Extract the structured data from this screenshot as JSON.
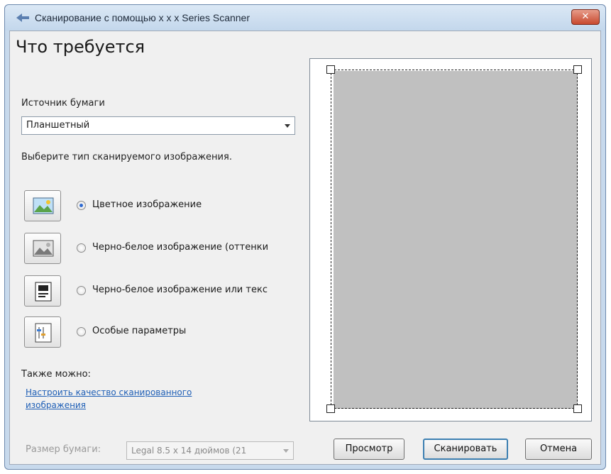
{
  "window": {
    "title": "Сканирование с помощью  x x x  Series Scanner",
    "close_label": "✕"
  },
  "left": {
    "heading": "Что требуется",
    "source_label": "Источник бумаги",
    "source_value": "Планшетный",
    "type_prompt": "Выберите тип сканируемого изображения.",
    "types": [
      {
        "label": "Цветное изображение",
        "selected": true,
        "icon": "color-image-icon"
      },
      {
        "label": "Черно-белое изображение (оттенки",
        "selected": false,
        "icon": "grayscale-image-icon"
      },
      {
        "label": "Черно-белое изображение или текс",
        "selected": false,
        "icon": "bw-text-icon"
      },
      {
        "label": "Особые параметры",
        "selected": false,
        "icon": "custom-settings-icon"
      }
    ],
    "also_label": "Также можно:",
    "link_line1": "Настроить качество сканированного",
    "link_line2": "изображения",
    "page_size_label": "Размер бумаги:",
    "page_size_value": "Legal 8.5 x 14 дюймов (21"
  },
  "buttons": {
    "preview": "Просмотр",
    "scan": "Сканировать",
    "cancel": "Отмена"
  },
  "colors": {
    "accent": "#2e6ad1",
    "link": "#1f5fb6",
    "sheet": "#c0c0c0"
  }
}
